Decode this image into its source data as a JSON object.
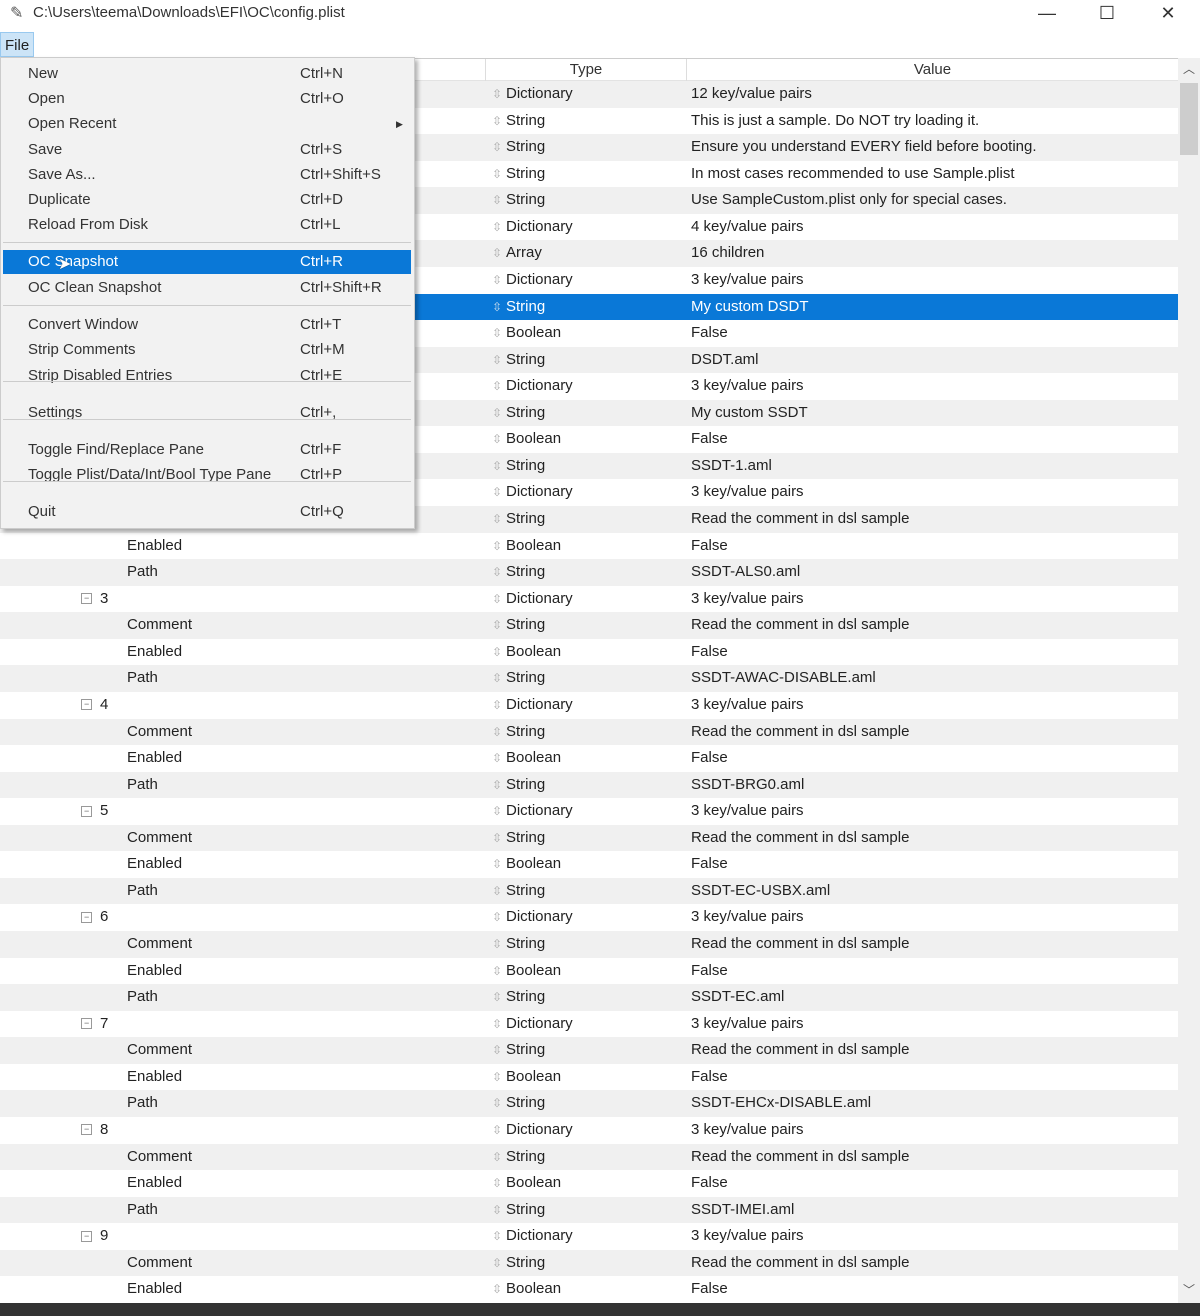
{
  "window": {
    "title": "C:\\Users\\teema\\Downloads\\EFI\\OC\\config.plist",
    "minimize": "—",
    "maximize": "☐",
    "close": "✕"
  },
  "menubar": {
    "file": "File"
  },
  "file_menu": {
    "items": [
      {
        "label": "New",
        "shortcut": "Ctrl+N"
      },
      {
        "label": "Open",
        "shortcut": "Ctrl+O"
      },
      {
        "label": "Open Recent",
        "shortcut": "",
        "submenu": true
      },
      {
        "label": "Save",
        "shortcut": "Ctrl+S"
      },
      {
        "label": "Save As...",
        "shortcut": "Ctrl+Shift+S"
      },
      {
        "label": "Duplicate",
        "shortcut": "Ctrl+D"
      },
      {
        "label": "Reload From Disk",
        "shortcut": "Ctrl+L"
      },
      {
        "separator": true
      },
      {
        "label": "OC Snapshot",
        "shortcut": "Ctrl+R",
        "highlighted": true
      },
      {
        "label": "OC Clean Snapshot",
        "shortcut": "Ctrl+Shift+R"
      },
      {
        "separator": true
      },
      {
        "label": "Convert Window",
        "shortcut": "Ctrl+T"
      },
      {
        "label": "Strip Comments",
        "shortcut": "Ctrl+M"
      },
      {
        "label": "Strip Disabled Entries",
        "shortcut": "Ctrl+E"
      },
      {
        "separator": true
      },
      {
        "label": "Settings",
        "shortcut": "Ctrl+,"
      },
      {
        "separator": true
      },
      {
        "label": "Toggle Find/Replace Pane",
        "shortcut": "Ctrl+F"
      },
      {
        "label": "Toggle Plist/Data/Int/Bool Type Pane",
        "shortcut": "Ctrl+P"
      },
      {
        "separator": true
      },
      {
        "label": "Quit",
        "shortcut": "Ctrl+Q"
      }
    ]
  },
  "columns": {
    "key": "",
    "type": "Type",
    "value": "Value"
  },
  "rows": [
    {
      "key": "",
      "type": "Dictionary",
      "value": "12 key/value pairs"
    },
    {
      "key": "",
      "type": "String",
      "value": "This is just a sample. Do NOT try loading it."
    },
    {
      "key": "",
      "type": "String",
      "value": "Ensure you understand EVERY field before booting."
    },
    {
      "key": "",
      "type": "String",
      "value": "In most cases recommended to use Sample.plist"
    },
    {
      "key": "",
      "type": "String",
      "value": "Use SampleCustom.plist only for special cases."
    },
    {
      "key": "",
      "type": "Dictionary",
      "value": "4 key/value pairs"
    },
    {
      "key": "",
      "type": "Array",
      "value": "16 children"
    },
    {
      "key": "",
      "type": "Dictionary",
      "value": "3 key/value pairs"
    },
    {
      "key": "",
      "type": "String",
      "value": "My custom DSDT",
      "selected": true
    },
    {
      "key": "",
      "type": "Boolean",
      "value": "False"
    },
    {
      "key": "",
      "type": "String",
      "value": "DSDT.aml"
    },
    {
      "key": "",
      "type": "Dictionary",
      "value": "3 key/value pairs"
    },
    {
      "key": "",
      "type": "String",
      "value": "My custom SSDT"
    },
    {
      "key": "",
      "type": "Boolean",
      "value": "False"
    },
    {
      "key": "",
      "type": "String",
      "value": "SSDT-1.aml"
    },
    {
      "key": "",
      "type": "Dictionary",
      "value": "3 key/value pairs"
    },
    {
      "key": "",
      "type": "String",
      "value": "Read the comment in dsl sample"
    },
    {
      "key": "Enabled",
      "type": "Boolean",
      "value": "False"
    },
    {
      "key": "Path",
      "type": "String",
      "value": "SSDT-ALS0.aml"
    },
    {
      "key": "3",
      "group": true,
      "type": "Dictionary",
      "value": "3 key/value pairs"
    },
    {
      "key": "Comment",
      "type": "String",
      "value": "Read the comment in dsl sample"
    },
    {
      "key": "Enabled",
      "type": "Boolean",
      "value": "False"
    },
    {
      "key": "Path",
      "type": "String",
      "value": "SSDT-AWAC-DISABLE.aml"
    },
    {
      "key": "4",
      "group": true,
      "type": "Dictionary",
      "value": "3 key/value pairs"
    },
    {
      "key": "Comment",
      "type": "String",
      "value": "Read the comment in dsl sample"
    },
    {
      "key": "Enabled",
      "type": "Boolean",
      "value": "False"
    },
    {
      "key": "Path",
      "type": "String",
      "value": "SSDT-BRG0.aml"
    },
    {
      "key": "5",
      "group": true,
      "type": "Dictionary",
      "value": "3 key/value pairs"
    },
    {
      "key": "Comment",
      "type": "String",
      "value": "Read the comment in dsl sample"
    },
    {
      "key": "Enabled",
      "type": "Boolean",
      "value": "False"
    },
    {
      "key": "Path",
      "type": "String",
      "value": "SSDT-EC-USBX.aml"
    },
    {
      "key": "6",
      "group": true,
      "type": "Dictionary",
      "value": "3 key/value pairs"
    },
    {
      "key": "Comment",
      "type": "String",
      "value": "Read the comment in dsl sample"
    },
    {
      "key": "Enabled",
      "type": "Boolean",
      "value": "False"
    },
    {
      "key": "Path",
      "type": "String",
      "value": "SSDT-EC.aml"
    },
    {
      "key": "7",
      "group": true,
      "type": "Dictionary",
      "value": "3 key/value pairs"
    },
    {
      "key": "Comment",
      "type": "String",
      "value": "Read the comment in dsl sample"
    },
    {
      "key": "Enabled",
      "type": "Boolean",
      "value": "False"
    },
    {
      "key": "Path",
      "type": "String",
      "value": "SSDT-EHCx-DISABLE.aml"
    },
    {
      "key": "8",
      "group": true,
      "type": "Dictionary",
      "value": "3 key/value pairs"
    },
    {
      "key": "Comment",
      "type": "String",
      "value": "Read the comment in dsl sample"
    },
    {
      "key": "Enabled",
      "type": "Boolean",
      "value": "False"
    },
    {
      "key": "Path",
      "type": "String",
      "value": "SSDT-IMEI.aml"
    },
    {
      "key": "9",
      "group": true,
      "type": "Dictionary",
      "value": "3 key/value pairs"
    },
    {
      "key": "Comment",
      "type": "String",
      "value": "Read the comment in dsl sample"
    },
    {
      "key": "Enabled",
      "type": "Boolean",
      "value": "False"
    }
  ],
  "colors": {
    "selection": "#0a78d7",
    "row_alt": "#f0f0f0"
  }
}
